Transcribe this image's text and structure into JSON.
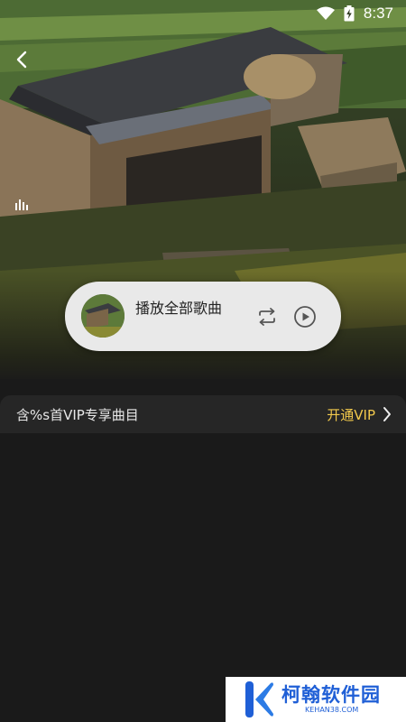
{
  "status_bar": {
    "time": "8:37"
  },
  "player": {
    "play_all_label": "播放全部歌曲"
  },
  "vip": {
    "notice": "含%s首VIP专享曲目",
    "open_label": "开通VIP",
    "accent_color": "#f2c94c"
  },
  "watermark": {
    "name": "柯翰软件园",
    "domain": "KEHAN38.COM"
  }
}
